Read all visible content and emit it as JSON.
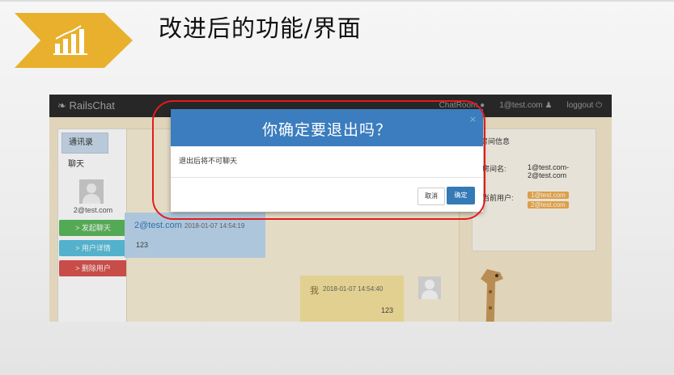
{
  "slide": {
    "title": "改进后的功能/界面",
    "badge_icon": "bar-chart-icon",
    "badge_color": "#e8b02c"
  },
  "app": {
    "brand": "RailsChat",
    "nav": {
      "chatroom": "ChatRoom",
      "user": "1@test.com",
      "logout": "loggout"
    },
    "left_panel": {
      "tabs": [
        "通讯录",
        "聊天"
      ],
      "user_email": "2@test.com",
      "buttons": [
        {
          "label": "> 发起聊天",
          "color": "#5cb85c"
        },
        {
          "label": "> 用户详情",
          "color": "#5bc0de"
        },
        {
          "label": "> 删除用户",
          "color": "#d9534f"
        }
      ]
    },
    "messages": [
      {
        "sender": "2@test.com",
        "time": "2018-01-07 14:54:19",
        "text": "123"
      },
      {
        "sender": "我",
        "time": "2018-01-07 14:54:40",
        "text": "123"
      }
    ],
    "room_info": {
      "title": "房间信息",
      "room_name_label": "房间名:",
      "room_name_value": "1@test.com-2@test.com",
      "current_users_label": "当前用户:",
      "current_users": [
        "1@test.com",
        "2@test.com"
      ]
    },
    "modal": {
      "title": "你确定要退出吗？",
      "close": "×",
      "body": "退出后将不可聊天",
      "cancel": "取消",
      "ok": "确定"
    }
  }
}
